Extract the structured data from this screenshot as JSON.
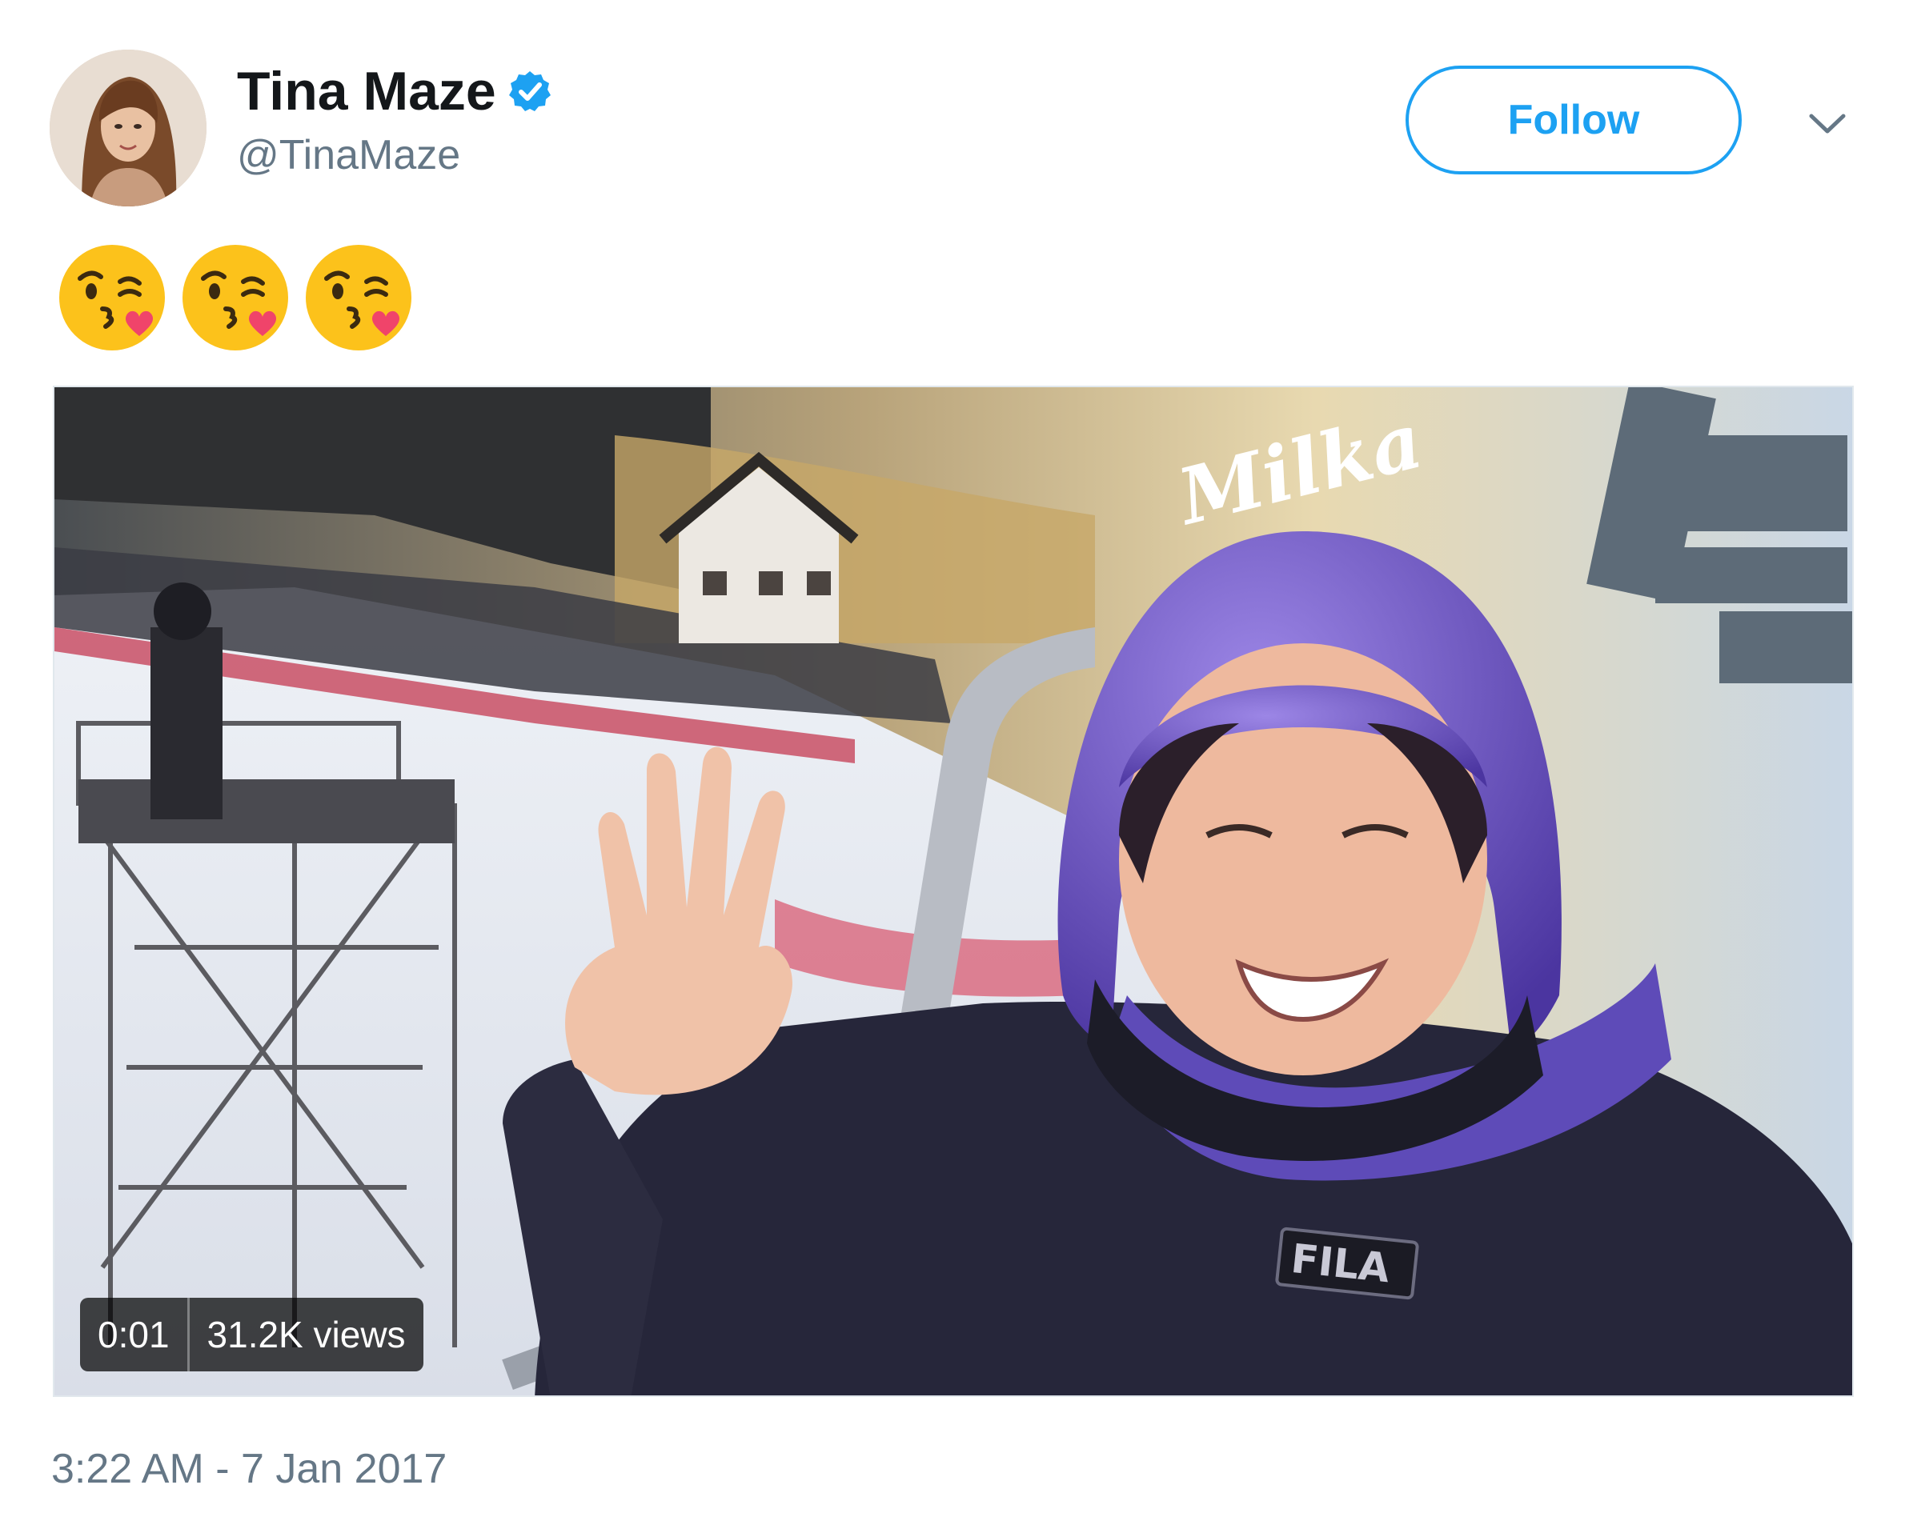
{
  "tweet": {
    "author": {
      "display_name": "Tina Maze",
      "handle": "@TinaMaze",
      "verified": true
    },
    "follow_label": "Follow",
    "text_emoji": [
      "😘",
      "😘",
      "😘"
    ],
    "media": {
      "type": "video",
      "elapsed": "0:01",
      "views": "31.2K views",
      "logos_in_scene": [
        "Milka",
        "FILA"
      ]
    },
    "timestamp": "3:22 AM - 7 Jan 2017"
  },
  "colors": {
    "link_blue": "#1da1f2",
    "secondary_text": "#657786",
    "helmet_purple": "#6b4fbf"
  },
  "icons": {
    "verified": "verified-badge-icon",
    "menu": "chevron-down-icon"
  }
}
